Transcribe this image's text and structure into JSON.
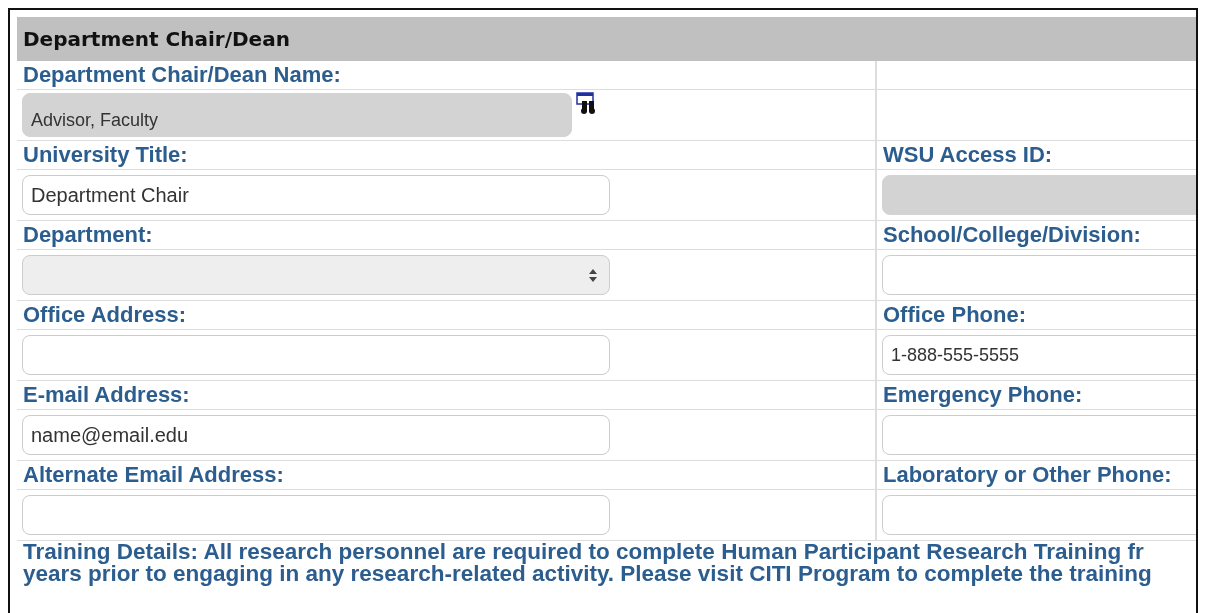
{
  "section": {
    "title": "Department Chair/Dean"
  },
  "rows": [
    {
      "left": {
        "label": "Department Chair/Dean Name:",
        "field": {
          "kind": "readonly",
          "value": "Advisor, Faculty",
          "lookup": true
        }
      }
    },
    {
      "left": {
        "label": "University Title:",
        "field": {
          "kind": "text",
          "value": "Department Chair"
        }
      },
      "right": {
        "label": "WSU Access ID:",
        "field": {
          "kind": "readonly"
        }
      }
    },
    {
      "left": {
        "label": "Department:",
        "field": {
          "kind": "select",
          "disabled": true
        }
      },
      "right": {
        "label": "School/College/Division:",
        "field": {
          "kind": "text"
        }
      }
    },
    {
      "left": {
        "label": "Office Address:",
        "field": {
          "kind": "text"
        }
      },
      "right": {
        "label": "Office Phone:",
        "field": {
          "kind": "text",
          "value": "1-888-555-5555"
        }
      }
    },
    {
      "left": {
        "label": "E-mail Address:",
        "field": {
          "kind": "text",
          "value": "name@email.edu"
        }
      },
      "right": {
        "label": "Emergency Phone:",
        "field": {
          "kind": "text"
        }
      }
    },
    {
      "left": {
        "label": "Alternate Email Address:",
        "field": {
          "kind": "text"
        }
      },
      "right": {
        "label": "Laboratory or Other Phone:",
        "field": {
          "kind": "text"
        }
      }
    }
  ],
  "training_note": [
    "Training Details: All research personnel are required to complete Human Participant Research Training fr",
    "years prior to engaging in any research-related activity. Please visit CITI Program to complete the training"
  ]
}
